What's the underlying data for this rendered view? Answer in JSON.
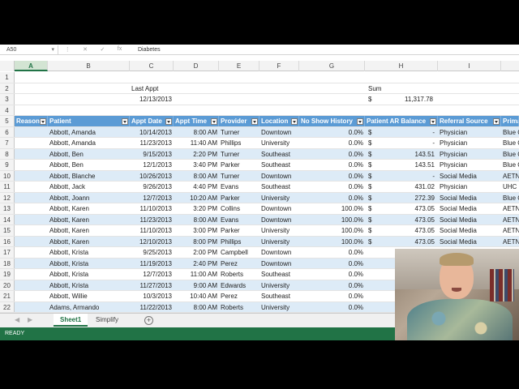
{
  "formula": {
    "name_box": "A50",
    "value": "Diabetes"
  },
  "columns": [
    {
      "letter": "A",
      "selected": true
    },
    {
      "letter": "B"
    },
    {
      "letter": "C"
    },
    {
      "letter": "D"
    },
    {
      "letter": "E"
    },
    {
      "letter": "F"
    },
    {
      "letter": "G"
    },
    {
      "letter": "H"
    },
    {
      "letter": "I"
    }
  ],
  "summary": {
    "last_appt_label": "Last Appt",
    "last_appt_value": "12/13/2013",
    "sum_label": "Sum",
    "sum_currency": "$",
    "sum_value": "11,317.78"
  },
  "row_numbers": [
    "1",
    "2",
    "3",
    "4",
    "5",
    "6",
    "7",
    "8",
    "9",
    "10",
    "11",
    "12",
    "13",
    "14",
    "15",
    "16",
    "17",
    "18",
    "19",
    "20",
    "21",
    "22"
  ],
  "table_headers": [
    "Reason",
    "Patient",
    "Appt Date",
    "Appt Time",
    "Provider",
    "Location",
    "No Show History",
    "Patient AR Balance",
    "Referral Source",
    "Prima"
  ],
  "rows": [
    {
      "patient": "Abbott, Amanda",
      "date": "10/14/2013",
      "time": "8:00 AM",
      "provider": "Turner",
      "location": "Downtown",
      "noshow": "0.0%",
      "cur": "$",
      "ar": "-",
      "referral": "Physician",
      "prima": "Blue C"
    },
    {
      "patient": "Abbott, Amanda",
      "date": "11/23/2013",
      "time": "11:40 AM",
      "provider": "Phillips",
      "location": "University",
      "noshow": "0.0%",
      "cur": "$",
      "ar": "-",
      "referral": "Physician",
      "prima": "Blue C"
    },
    {
      "patient": "Abbott, Ben",
      "date": "9/15/2013",
      "time": "2:20 PM",
      "provider": "Turner",
      "location": "Southeast",
      "noshow": "0.0%",
      "cur": "$",
      "ar": "143.51",
      "referral": "Physician",
      "prima": "Blue C"
    },
    {
      "patient": "Abbott, Ben",
      "date": "12/1/2013",
      "time": "3:40 PM",
      "provider": "Parker",
      "location": "Southeast",
      "noshow": "0.0%",
      "cur": "$",
      "ar": "143.51",
      "referral": "Physician",
      "prima": "Blue C"
    },
    {
      "patient": "Abbott, Blanche",
      "date": "10/26/2013",
      "time": "8:00 AM",
      "provider": "Turner",
      "location": "Downtown",
      "noshow": "0.0%",
      "cur": "$",
      "ar": "-",
      "referral": "Social Media",
      "prima": "AETNA"
    },
    {
      "patient": "Abbott, Jack",
      "date": "9/26/2013",
      "time": "4:40 PM",
      "provider": "Evans",
      "location": "Southeast",
      "noshow": "0.0%",
      "cur": "$",
      "ar": "431.02",
      "referral": "Physician",
      "prima": "UHC"
    },
    {
      "patient": "Abbott, Joann",
      "date": "12/7/2013",
      "time": "10:20 AM",
      "provider": "Parker",
      "location": "University",
      "noshow": "0.0%",
      "cur": "$",
      "ar": "272.39",
      "referral": "Social Media",
      "prima": "Blue C"
    },
    {
      "patient": "Abbott, Karen",
      "date": "11/10/2013",
      "time": "3:20 PM",
      "provider": "Collins",
      "location": "Downtown",
      "noshow": "100.0%",
      "cur": "$",
      "ar": "473.05",
      "referral": "Social Media",
      "prima": "AETNA"
    },
    {
      "patient": "Abbott, Karen",
      "date": "11/23/2013",
      "time": "8:00 AM",
      "provider": "Evans",
      "location": "Downtown",
      "noshow": "100.0%",
      "cur": "$",
      "ar": "473.05",
      "referral": "Social Media",
      "prima": "AETNA"
    },
    {
      "patient": "Abbott, Karen",
      "date": "11/10/2013",
      "time": "3:00 PM",
      "provider": "Parker",
      "location": "University",
      "noshow": "100.0%",
      "cur": "$",
      "ar": "473.05",
      "referral": "Social Media",
      "prima": "AETNA"
    },
    {
      "patient": "Abbott, Karen",
      "date": "12/10/2013",
      "time": "8:00 PM",
      "provider": "Phillips",
      "location": "University",
      "noshow": "100.0%",
      "cur": "$",
      "ar": "473.05",
      "referral": "Social Media",
      "prima": "AETNA"
    },
    {
      "patient": "Abbott, Krista",
      "date": "9/25/2013",
      "time": "2:00 PM",
      "provider": "Campbell",
      "location": "Downtown",
      "noshow": "0.0%",
      "cur": "",
      "ar": "",
      "referral": "",
      "prima": ""
    },
    {
      "patient": "Abbott, Krista",
      "date": "11/19/2013",
      "time": "2:40 PM",
      "provider": "Perez",
      "location": "Downtown",
      "noshow": "0.0%",
      "cur": "",
      "ar": "",
      "referral": "",
      "prima": ""
    },
    {
      "patient": "Abbott, Krista",
      "date": "12/7/2013",
      "time": "11:00 AM",
      "provider": "Roberts",
      "location": "Southeast",
      "noshow": "0.0%",
      "cur": "",
      "ar": "",
      "referral": "",
      "prima": ""
    },
    {
      "patient": "Abbott, Krista",
      "date": "11/27/2013",
      "time": "9:00 AM",
      "provider": "Edwards",
      "location": "University",
      "noshow": "0.0%",
      "cur": "",
      "ar": "",
      "referral": "",
      "prima": ""
    },
    {
      "patient": "Abbott, Willie",
      "date": "10/3/2013",
      "time": "10:40 AM",
      "provider": "Perez",
      "location": "Southeast",
      "noshow": "0.0%",
      "cur": "",
      "ar": "",
      "referral": "",
      "prima": ""
    },
    {
      "patient": "Adams, Armando",
      "date": "11/22/2013",
      "time": "8:00 AM",
      "provider": "Roberts",
      "location": "University",
      "noshow": "0.0%",
      "cur": "",
      "ar": "",
      "referral": "",
      "prima": ""
    }
  ],
  "sheet_tabs": [
    "Sheet1",
    "Simplify"
  ],
  "active_tab": "Sheet1",
  "status": "READY"
}
